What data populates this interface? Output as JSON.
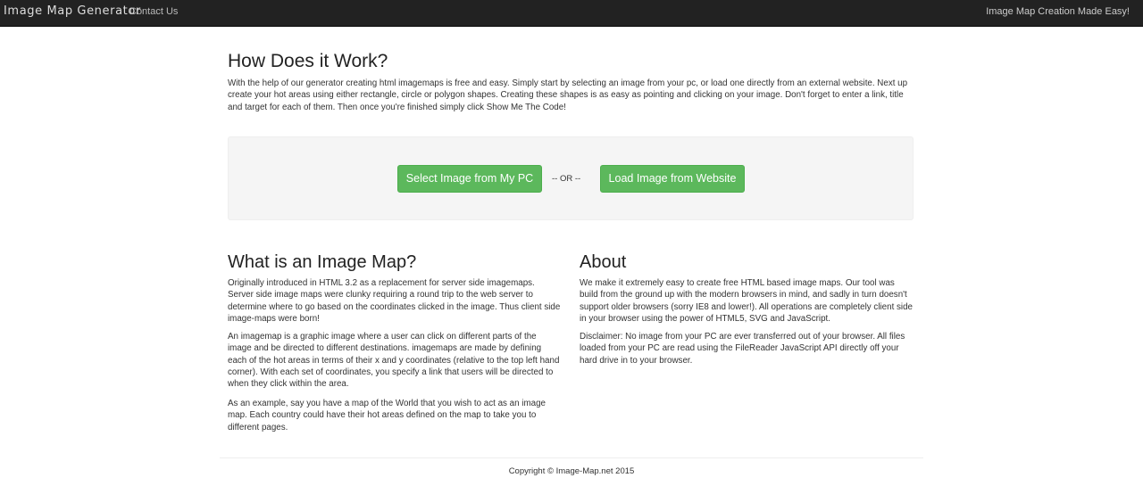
{
  "navbar": {
    "brand": "Image Map Generator",
    "contact_link": "Contact Us",
    "tagline": "Image Map Creation Made Easy!"
  },
  "howto": {
    "title": "How Does it Work?",
    "text": "With the help of our generator creating html imagemaps is free and easy. Simply start by selecting an image from your pc, or load one directly from an external website. Next up create your hot areas using either rectangle, circle or polygon shapes. Creating these shapes is as easy as pointing and clicking on your image. Don't forget to enter a link, title and target for each of them. Then once you're finished simply click Show Me The Code!"
  },
  "loader": {
    "select_pc_label": "Select Image from My PC",
    "or_text": "-- OR --",
    "load_web_label": "Load Image from Website"
  },
  "what_is": {
    "title": "What is an Image Map?",
    "paragraphs": [
      "Originally introduced in HTML 3.2 as a replacement for server side imagemaps. Server side image maps were clunky requiring a round trip to the web server to determine where to go based on the coordinates clicked in the image. Thus client side image-maps were born!",
      "An imagemap is a graphic image where a user can click on different parts of the image and be directed to different destinations. imagemaps are made by defining each of the hot areas in terms of their x and y coordinates (relative to the top left hand corner). With each set of coordinates, you specify a link that users will be directed to when they click within the area.",
      "As an example, say you have a map of the World that you wish to act as an image map. Each country could have their hot areas defined on the map to take you to different pages."
    ]
  },
  "about": {
    "title": "About",
    "paragraphs": [
      "We make it extremely easy to create free HTML based image maps. Our tool was build from the ground up with the modern browsers in mind, and sadly in turn doesn't support older browsers (sorry IE8 and lower!). All operations are completely client side in your browser using the power of HTML5, SVG and JavaScript.",
      "Disclaimer: No image from your PC are ever transferred out of your browser. All files loaded from your PC are read using the FileReader JavaScript API directly off your hard drive in to your browser."
    ]
  },
  "footer": {
    "copyright": "Copyright © Image-Map.net 2015"
  },
  "colors": {
    "navbar_bg": "#222222",
    "button_green": "#5cb85c",
    "well_bg": "#f5f5f5"
  }
}
